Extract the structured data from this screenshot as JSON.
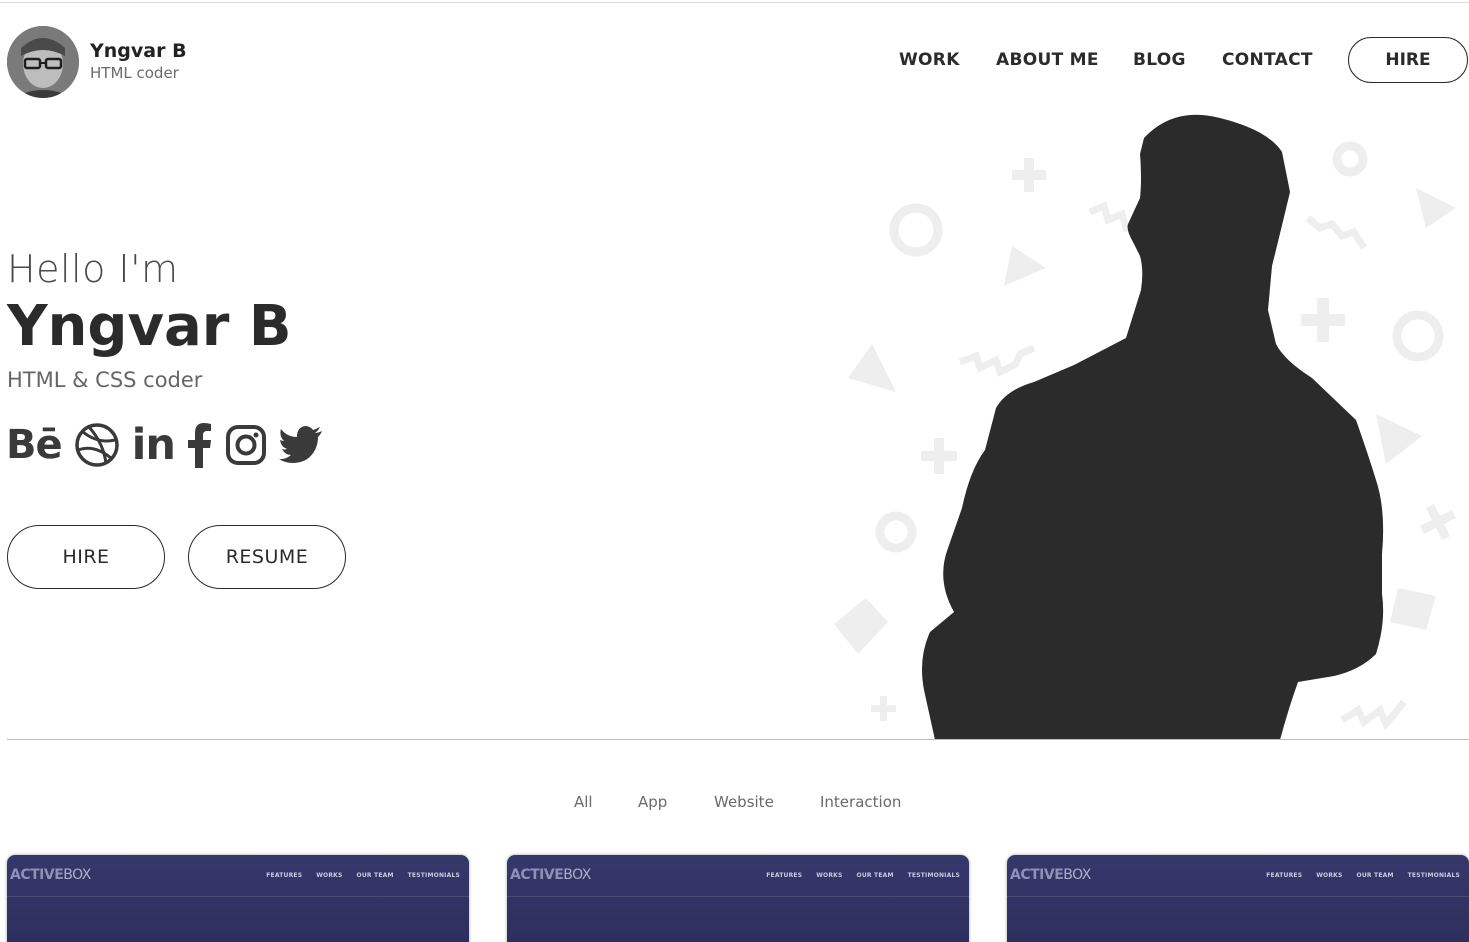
{
  "header": {
    "name": "Yngvar B",
    "role": "HTML coder",
    "nav": [
      "WORK",
      "ABOUT ME",
      "BLOG",
      "CONTACT"
    ],
    "hire_label": "HIRE"
  },
  "hero": {
    "greeting": "Hello I'm",
    "name": "Yngvar B",
    "role": "HTML & CSS coder",
    "social": {
      "behance": "Bē",
      "linkedin": "in",
      "icons": [
        "behance-icon",
        "dribbble-icon",
        "linkedin-icon",
        "facebook-icon",
        "instagram-icon",
        "twitter-icon"
      ]
    },
    "buttons": {
      "hire": "HIRE",
      "resume": "RESUME"
    }
  },
  "filters": [
    "All",
    "App",
    "Website",
    "Interaction"
  ],
  "cards": [
    {
      "logo_bold": "ACTIVE",
      "logo_thin": "BOX",
      "menu": [
        "FEATURES",
        "WORKS",
        "OUR TEAM",
        "TESTIMONIALS"
      ]
    },
    {
      "logo_bold": "ACTIVE",
      "logo_thin": "BOX",
      "menu": [
        "FEATURES",
        "WORKS",
        "OUR TEAM",
        "TESTIMONIALS"
      ]
    },
    {
      "logo_bold": "ACTIVE",
      "logo_thin": "BOX",
      "menu": [
        "FEATURES",
        "WORKS",
        "OUR TEAM",
        "TESTIMONIALS"
      ]
    }
  ],
  "colors": {
    "text": "#2b2b2b",
    "muted": "#6a6a6a",
    "card": "#2f325f",
    "shapes": "#efefef"
  }
}
